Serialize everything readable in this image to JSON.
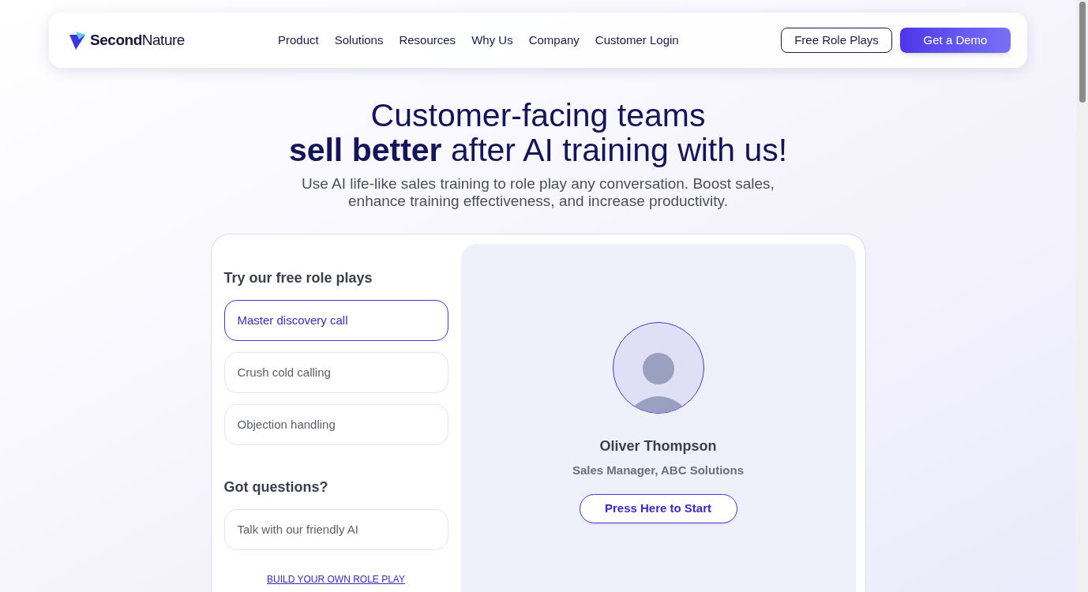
{
  "header": {
    "logo": {
      "bold": "Second",
      "regular": "Nature"
    },
    "nav": [
      "Product",
      "Solutions",
      "Resources",
      "Why Us",
      "Company",
      "Customer Login"
    ],
    "buttons": [
      {
        "label": "Free Role Plays",
        "kind": "outline"
      },
      {
        "label": "Get a Demo",
        "kind": "primary"
      }
    ]
  },
  "hero": {
    "title_line1": "Customer-facing teams",
    "title_line2": "**sell better** after AI training with us!",
    "subtitle": "Use AI life-like sales training to role play any conversation. Boost sales, enhance training effectiveness, and increase productivity."
  },
  "demo": {
    "roleplays_heading": "Try our free role plays",
    "roleplays": [
      {
        "label": "Master discovery call",
        "selected": true
      },
      {
        "label": "Crush cold calling",
        "selected": false
      },
      {
        "label": "Objection handling",
        "selected": false
      }
    ],
    "questions_heading": "Got questions?",
    "questions": [
      {
        "label": "Talk with our friendly AI",
        "selected": false
      }
    ],
    "build_link": "BUILD YOUR OWN ROLE PLAY",
    "persona": {
      "name": "Oliver Thompson",
      "role": "Sales Manager, ABC Solutions",
      "button": "Press Here to Start"
    }
  }
}
